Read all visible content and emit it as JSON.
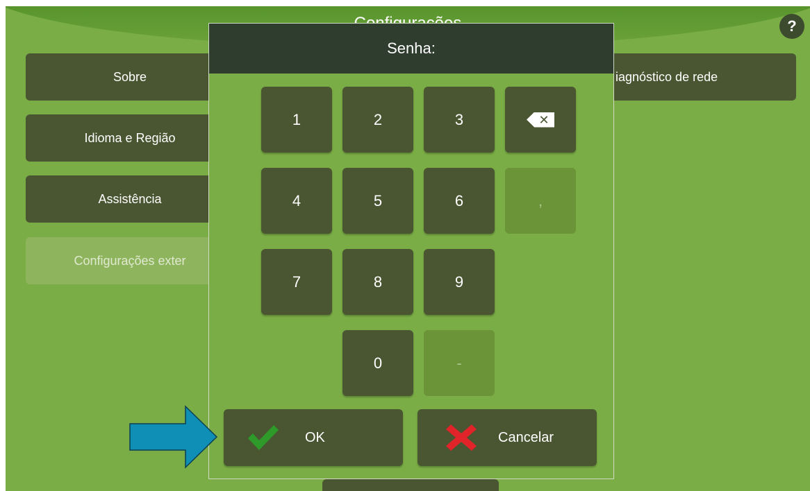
{
  "header": {
    "title": "Configurações",
    "help_label": "?"
  },
  "menu": {
    "about": "Sobre",
    "language_region": "Idioma e Região",
    "assistance": "Assistência",
    "external_settings": "Configurações exter",
    "network_diagnostics": "iagnóstico de rede"
  },
  "dialog": {
    "title": "Senha:",
    "keys": {
      "k1": "1",
      "k2": "2",
      "k3": "3",
      "k4": "4",
      "k5": "5",
      "k6": "6",
      "k7": "7",
      "k8": "8",
      "k9": "9",
      "k0": "0",
      "comma": ",",
      "minus": "-"
    },
    "ok_label": "OK",
    "cancel_label": "Cancelar"
  },
  "colors": {
    "background": "#7aad45",
    "button": "#4a5531",
    "dialog_header": "#2f3d2e",
    "ok_check": "#2e9a2a",
    "cancel_x": "#e0242a",
    "arrow": "#0f8fb5"
  },
  "icons": {
    "backspace": "backspace-icon",
    "ok": "check-icon",
    "cancel": "x-icon",
    "pointer": "arrow-right-icon"
  }
}
